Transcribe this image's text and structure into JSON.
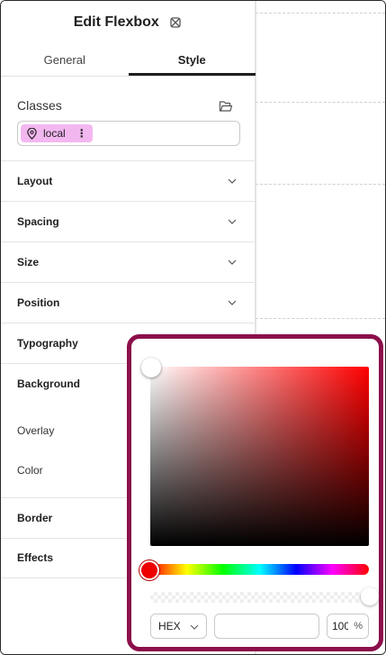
{
  "panel": {
    "title": "Edit Flexbox",
    "tabs": [
      {
        "label": "General",
        "active": false
      },
      {
        "label": "Style",
        "active": true
      }
    ],
    "classes": {
      "label": "Classes",
      "chip": {
        "label": "local",
        "color": "#f3b7f0"
      }
    },
    "sections": [
      {
        "label": "Layout"
      },
      {
        "label": "Spacing"
      },
      {
        "label": "Size"
      },
      {
        "label": "Position"
      },
      {
        "label": "Typography"
      },
      {
        "label": "Background"
      },
      {
        "label": "Border"
      },
      {
        "label": "Effects"
      }
    ],
    "background_fields": {
      "overlay_label": "Overlay",
      "color_label": "Color"
    }
  },
  "color_picker": {
    "border_color": "#8b0f4a",
    "hue_color": "#ff0000",
    "format": "HEX",
    "hex_value": "",
    "opacity_value": "100",
    "opacity_unit": "%",
    "saturation": 0,
    "brightness": 1,
    "alpha": 1
  },
  "icons": {
    "title_icon": "flexbox-icon",
    "folder": "folder-icon",
    "pin": "location-pin-icon",
    "more": "vertical-dots-icon",
    "chevron": "chevron-down-icon"
  }
}
